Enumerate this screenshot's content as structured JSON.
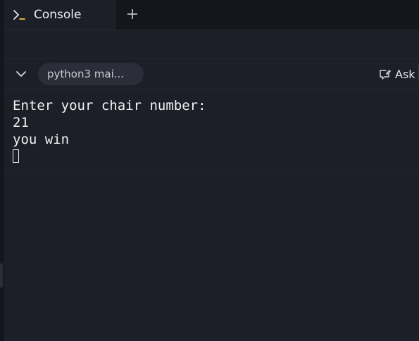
{
  "tabs": [
    {
      "label": "Console",
      "icon": "terminal-prompt-icon",
      "active": true
    }
  ],
  "add_tab_icon": "plus-icon",
  "session": {
    "pill_label": "python3 mai...",
    "ask_label": "Ask"
  },
  "console": {
    "lines": [
      "Enter your chair number:",
      "21",
      "you win"
    ]
  },
  "colors": {
    "background": "#1c1f27",
    "tabbar": "#14161b",
    "prompt_accent": "#f5c542",
    "pill": "#2b2e38",
    "text": "#f2f2f2"
  }
}
